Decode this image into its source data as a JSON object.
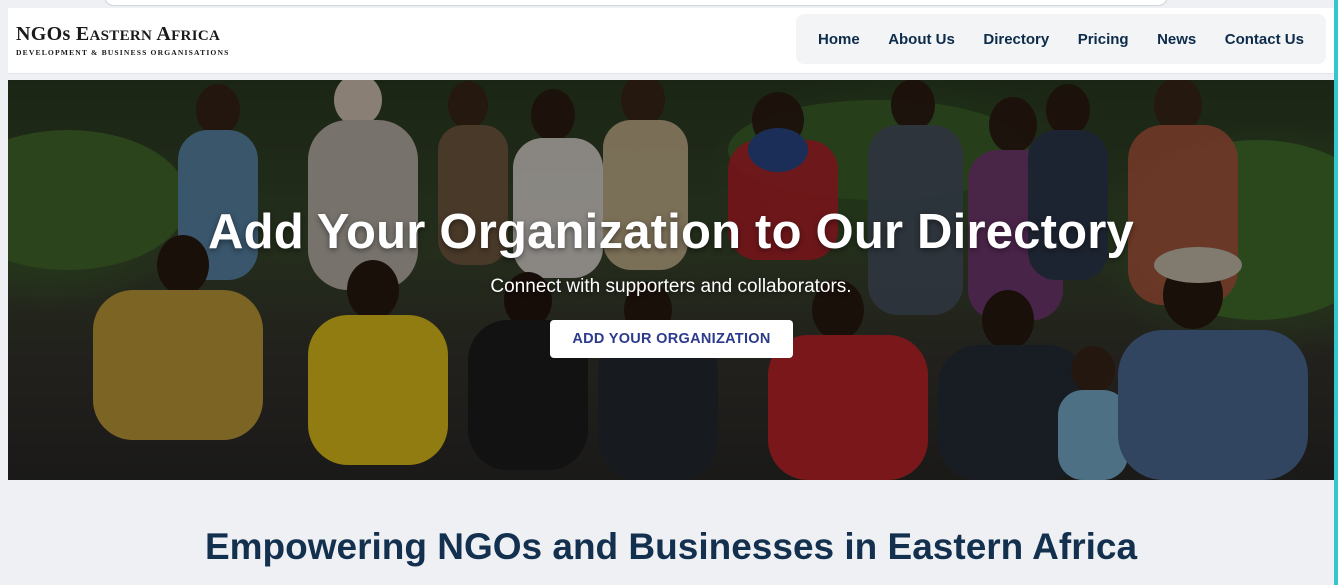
{
  "site": {
    "logo_title_main": "NGOs E",
    "logo_title_sc1": "ASTERN",
    "logo_title_a": " A",
    "logo_title_sc2": "FRICA",
    "logo_subtitle": "Development & Business Organisations"
  },
  "nav": {
    "items": [
      {
        "label": "Home"
      },
      {
        "label": "About Us"
      },
      {
        "label": "Directory"
      },
      {
        "label": "Pricing"
      },
      {
        "label": "News"
      },
      {
        "label": "Contact Us"
      }
    ]
  },
  "hero": {
    "title": "Add Your Organization to Our Directory",
    "subtitle": "Connect with supporters and collaborators.",
    "cta_label": "ADD YOUR ORGANIZATION"
  },
  "section": {
    "title": "Empowering NGOs and Businesses in Eastern Africa"
  },
  "colors": {
    "nav_text": "#0d2b4a",
    "cta_text": "#2c3a8c",
    "section_title": "#13304f",
    "accent_frame": "#33c6cd"
  }
}
